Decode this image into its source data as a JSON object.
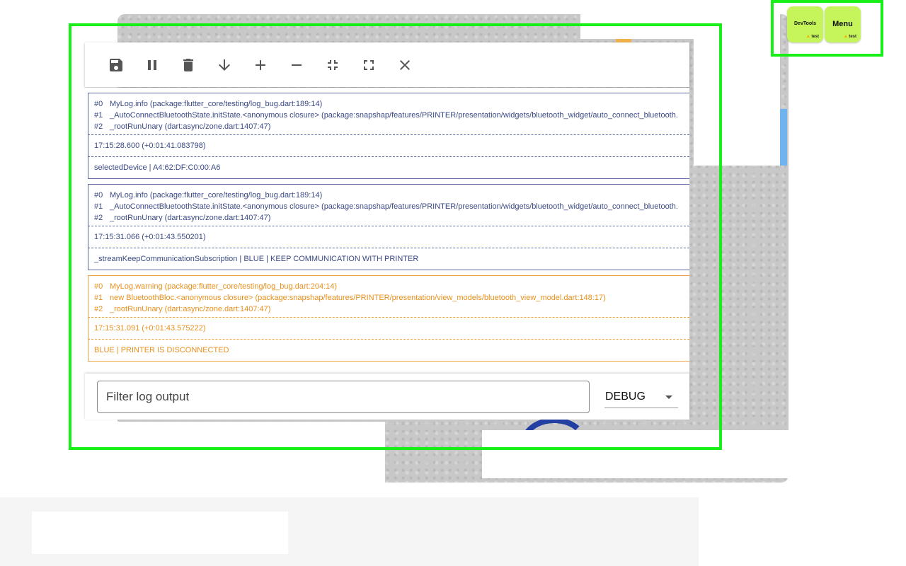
{
  "dev_buttons": {
    "devtools": {
      "label": "DevTools",
      "badge": "test"
    },
    "menu": {
      "label": "Menu",
      "badge": "test"
    }
  },
  "toolbar": {
    "buttons": [
      {
        "icon": "save-icon"
      },
      {
        "icon": "pause-icon"
      },
      {
        "icon": "delete-icon"
      },
      {
        "icon": "arrow-down-icon"
      },
      {
        "icon": "plus-icon"
      },
      {
        "icon": "minus-icon"
      },
      {
        "icon": "collapse-icon"
      },
      {
        "icon": "expand-icon"
      },
      {
        "icon": "close-icon"
      }
    ]
  },
  "logs": [
    {
      "level": "info",
      "stack": [
        {
          "idx": "#0",
          "text": "MyLog.info (package:flutter_core/testing/log_bug.dart:189:14)"
        },
        {
          "idx": "#1",
          "text": "_AutoConnectBluetoothState.initState.<anonymous closure> (package:snapshap/features/PRINTER/presentation/widgets/bluetooth_widget/auto_connect_bluetooth."
        },
        {
          "idx": "#2",
          "text": "_rootRunUnary (dart:async/zone.dart:1407:47)"
        }
      ],
      "time": "17:15:28.600 (+0:01:41.083798)",
      "message": "selectedDevice | A4:62:DF:C0:00:A6"
    },
    {
      "level": "info",
      "stack": [
        {
          "idx": "#0",
          "text": "MyLog.info (package:flutter_core/testing/log_bug.dart:189:14)"
        },
        {
          "idx": "#1",
          "text": "_AutoConnectBluetoothState.initState.<anonymous closure> (package:snapshap/features/PRINTER/presentation/widgets/bluetooth_widget/auto_connect_bluetooth."
        },
        {
          "idx": "#2",
          "text": "_rootRunUnary (dart:async/zone.dart:1407:47)"
        }
      ],
      "time": "17:15:31.066 (+0:01:43.550201)",
      "message": "_streamKeepCommunicationSubscription | BLUE | KEEP COMMUNICATION WITH PRINTER"
    },
    {
      "level": "warning",
      "stack": [
        {
          "idx": "#0",
          "text": "MyLog.warning (package:flutter_core/testing/log_bug.dart:204:14)"
        },
        {
          "idx": "#1",
          "text": "new BluetoothBloc.<anonymous closure> (package:snapshap/features/PRINTER/presentation/view_models/bluetooth_view_model.dart:148:17)"
        },
        {
          "idx": "#2",
          "text": "_rootRunUnary (dart:async/zone.dart:1407:47)"
        }
      ],
      "time": "17:15:31.091 (+0:01:43.575222)",
      "message": "BLUE | PRINTER IS DISCONNECTED"
    }
  ],
  "filter": {
    "placeholder": "Filter log output",
    "level": "DEBUG"
  },
  "colors": {
    "highlight": "#18ee18",
    "dev_button": "#c5f55a",
    "info_text": "#3a4a84",
    "warning_text": "#e8901d"
  }
}
